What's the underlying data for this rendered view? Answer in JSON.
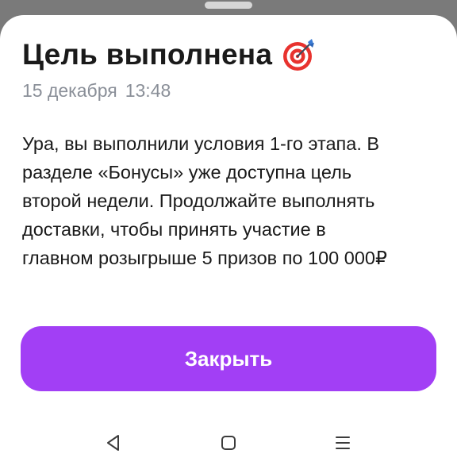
{
  "dialog": {
    "title": "Цель выполнена",
    "title_icon": "direct-hit-target-icon",
    "date": "15 декабря",
    "time": "13:48",
    "message_lines": [
      "Ура, вы выполнили условия 1-го этапа. В",
      "разделе «Бонусы» уже доступна цель",
      "второй недели. Продолжайте выполнять",
      "доставки, чтобы принять участие в",
      "главном розыгрыше 5 призов по 100 000₽"
    ],
    "close_label": "Закрыть"
  },
  "navbar": {
    "icons": [
      "back-triangle-icon",
      "home-square-icon",
      "recents-menu-icon"
    ]
  },
  "colors": {
    "accent": "#a23ff5",
    "backdrop": "#7a7a7a",
    "text_primary": "#1a1a1a",
    "text_secondary": "#8a8f98",
    "target_red": "#e8322e",
    "dart_blue": "#3a7bd5"
  }
}
